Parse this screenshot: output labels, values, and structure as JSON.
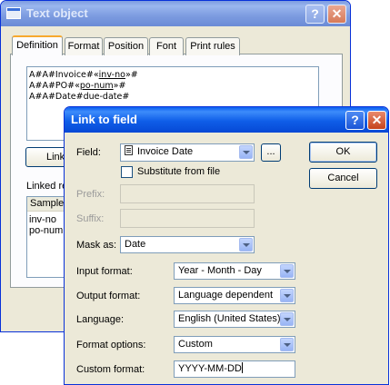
{
  "back_window": {
    "title": "Text object",
    "tabs": [
      "Definition",
      "Format",
      "Position",
      "Font",
      "Print rules"
    ],
    "text_lines": [
      {
        "pre": "A#A#Invoice#",
        "lq": "«",
        "field": "inv-no",
        "rq": "»",
        "post": "#"
      },
      {
        "pre": "A#A#PO#",
        "lq": "«",
        "field": "po-num",
        "rq": "»",
        "post": "#"
      },
      {
        "pre": "A#A#Date#due-date#",
        "lq": "",
        "field": "",
        "rq": "",
        "post": ""
      }
    ],
    "link_button_partial": "Link",
    "linked_label_partial": "Linked re",
    "sample_header_partial": "Sample",
    "linked_items": [
      "inv-no",
      "po-num"
    ]
  },
  "dialog": {
    "title": "Link to field",
    "field_label": "Field:",
    "field_value": "Invoice Date",
    "browse_label": "...",
    "ok_label": "OK",
    "cancel_label": "Cancel",
    "substitute_label": "Substitute from file",
    "prefix_label": "Prefix:",
    "suffix_label": "Suffix:",
    "mask_label": "Mask as:",
    "mask_value": "Date",
    "input_format_label": "Input format:",
    "input_format_value": "Year - Month - Day",
    "output_format_label": "Output format:",
    "output_format_value": "Language dependent",
    "language_label": "Language:",
    "language_value": "English (United States)",
    "format_options_label": "Format options:",
    "format_options_value": "Custom",
    "custom_format_label": "Custom format:",
    "custom_format_value": "YYYY-MM-DD"
  }
}
